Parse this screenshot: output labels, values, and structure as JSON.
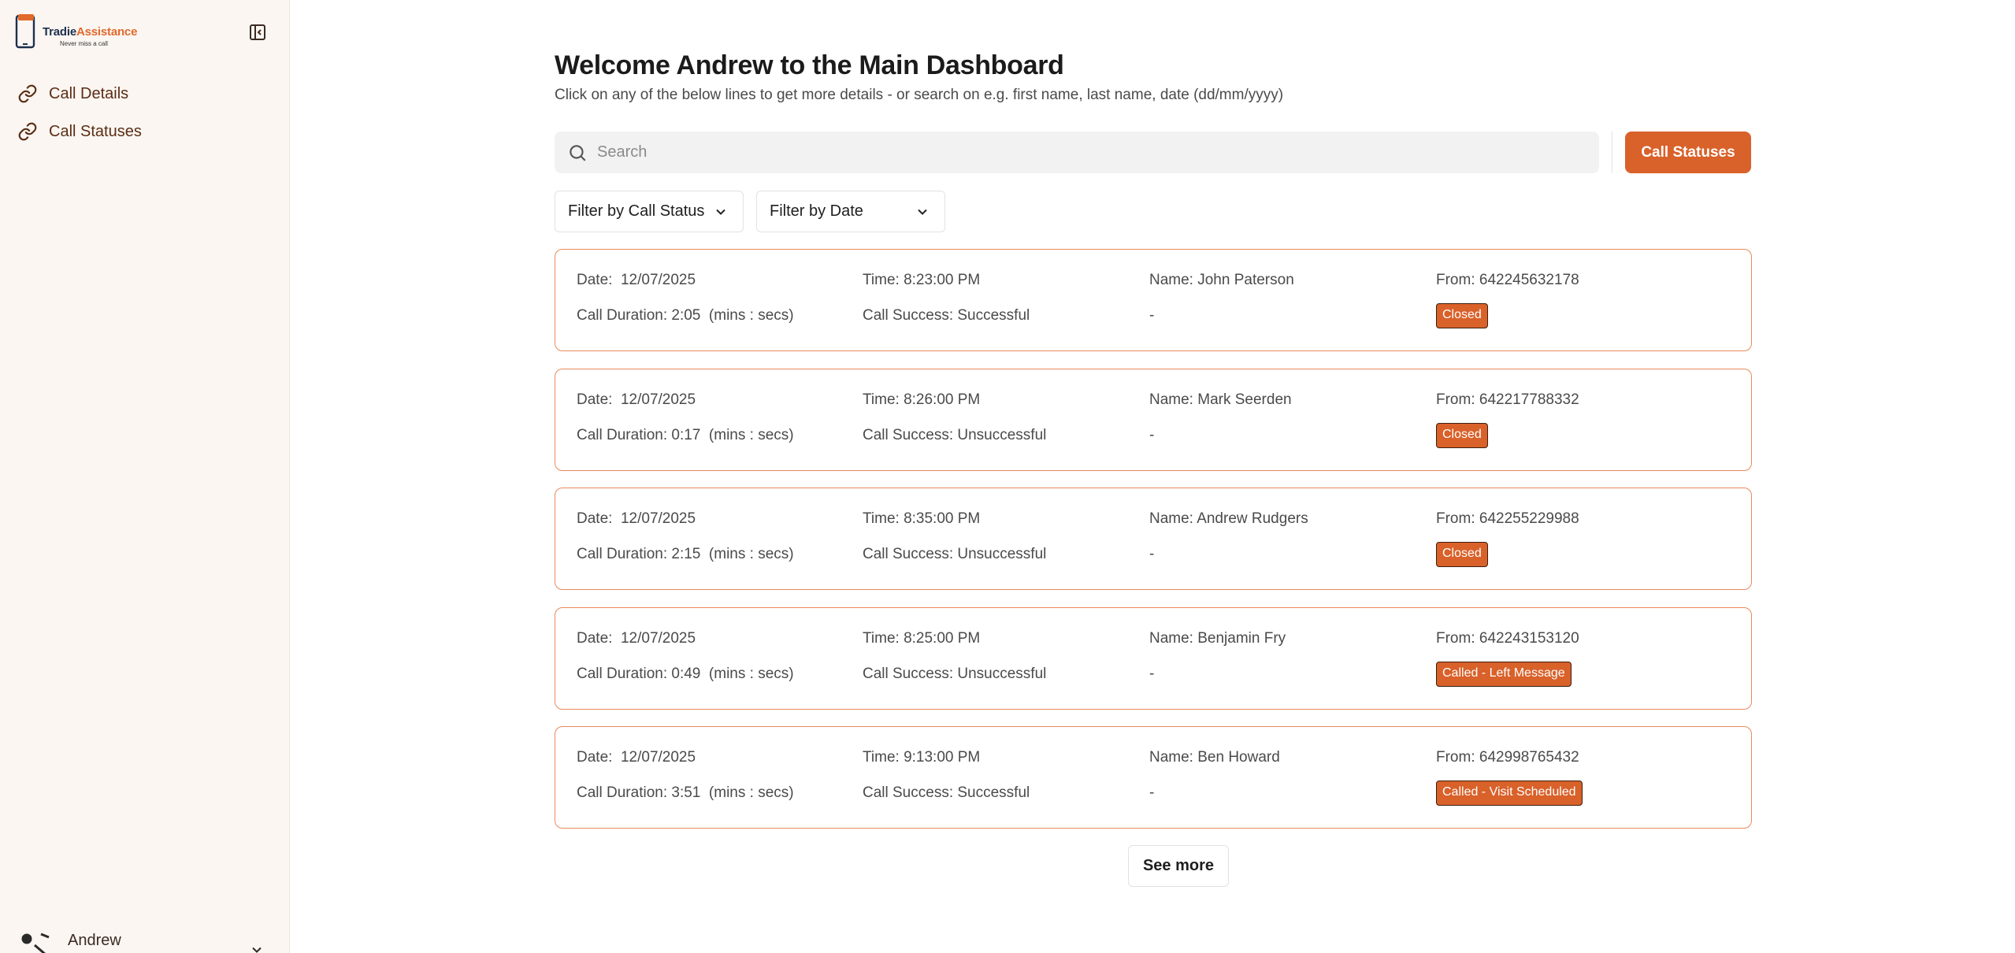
{
  "brand": {
    "name_part1": "Tradie",
    "name_part2": "Assistance",
    "tagline": "Never miss a call",
    "accent_color": "#d9612a"
  },
  "sidebar": {
    "collapse_icon": "sidebar-collapse-icon",
    "items": [
      {
        "label": "Call Details",
        "icon": "link-icon"
      },
      {
        "label": "Call Statuses",
        "icon": "link-icon"
      }
    ],
    "user": {
      "name": "Andrew",
      "icon": "user-switch-icon"
    }
  },
  "header": {
    "title": "Welcome Andrew to the Main Dashboard",
    "subtitle": "Click on any of the below lines to get more details - or search on e.g. first name, last name, date (dd/mm/yyyy)"
  },
  "search": {
    "placeholder": "Search",
    "value": ""
  },
  "toolbar": {
    "call_statuses_label": "Call Statuses"
  },
  "filters": {
    "status_label": "Filter by Call Status",
    "date_label": "Filter by Date"
  },
  "calls": [
    {
      "date": "Date:  12/07/2025",
      "time": "Time: 8:23:00 PM",
      "name": "Name: John Paterson",
      "from": "From: 642245632178",
      "duration": "Call Duration: 2:05  (mins : secs)",
      "success": "Call Success: Successful",
      "note": "-",
      "status": "Closed"
    },
    {
      "date": "Date:  12/07/2025",
      "time": "Time: 8:26:00 PM",
      "name": "Name: Mark Seerden",
      "from": "From: 642217788332",
      "duration": "Call Duration: 0:17  (mins : secs)",
      "success": "Call Success: Unsuccessful",
      "note": "-",
      "status": "Closed"
    },
    {
      "date": "Date:  12/07/2025",
      "time": "Time: 8:35:00 PM",
      "name": "Name: Andrew Rudgers",
      "from": "From: 642255229988",
      "duration": "Call Duration: 2:15  (mins : secs)",
      "success": "Call Success: Unsuccessful",
      "note": "-",
      "status": "Closed"
    },
    {
      "date": "Date:  12/07/2025",
      "time": "Time: 8:25:00 PM",
      "name": "Name: Benjamin Fry",
      "from": "From: 642243153120",
      "duration": "Call Duration: 0:49  (mins : secs)",
      "success": "Call Success: Unsuccessful",
      "note": "-",
      "status": "Called - Left Message"
    },
    {
      "date": "Date:  12/07/2025",
      "time": "Time: 9:13:00 PM",
      "name": "Name: Ben Howard",
      "from": "From: 642998765432",
      "duration": "Call Duration: 3:51  (mins : secs)",
      "success": "Call Success: Successful",
      "note": "-",
      "status": "Called - Visit Scheduled"
    }
  ],
  "see_more_label": "See more"
}
